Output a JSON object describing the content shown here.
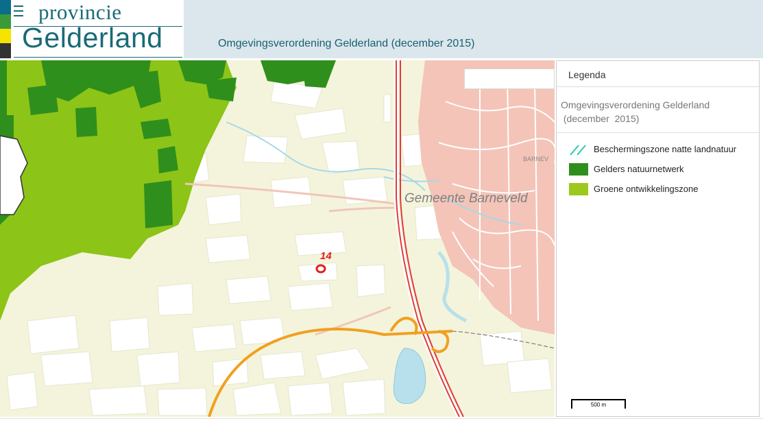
{
  "header": {
    "brand_line1": "provincie",
    "brand_line2": "Gelderland",
    "app_title": "Omgevingsverordening Gelderland (december 2015)",
    "stripe_colors": [
      "#0b6c8b",
      "#3a9a3a",
      "#f4e400",
      "#333333"
    ]
  },
  "map": {
    "place_label": "Gemeente  Barneveld",
    "town_label": "BARNEV",
    "marker_label": "14",
    "icons": [
      "menu-icon",
      "location-marker-icon"
    ]
  },
  "legend": {
    "title": "Legenda",
    "subtitle_line1": "Omgevingsverordening Gelderland",
    "subtitle_line2": " (december  2015)",
    "items": [
      {
        "label": "Beschermingszone natte landnatuur",
        "color": "#2cc8b0",
        "icon": "hatched-lines-icon"
      },
      {
        "label": "Gelders natuurnetwerk",
        "color": "#2f8f1c",
        "icon": "dark-green-square"
      },
      {
        "label": "Groene ontwikkelingszone",
        "color": "#9cc91c",
        "icon": "light-green-square"
      }
    ],
    "scale_label": "500 m"
  },
  "colors": {
    "base": "#f4f4dc",
    "parcel": "#ffffff",
    "urban": "#f4c4b8",
    "water": "#b8e0ec",
    "natuurnetwerk": "#2f8f1c",
    "ontwikkelingszone": "#8cc417",
    "railway": "#e03a3a",
    "motorway": "#f0a020",
    "marker": "#e0201c"
  }
}
